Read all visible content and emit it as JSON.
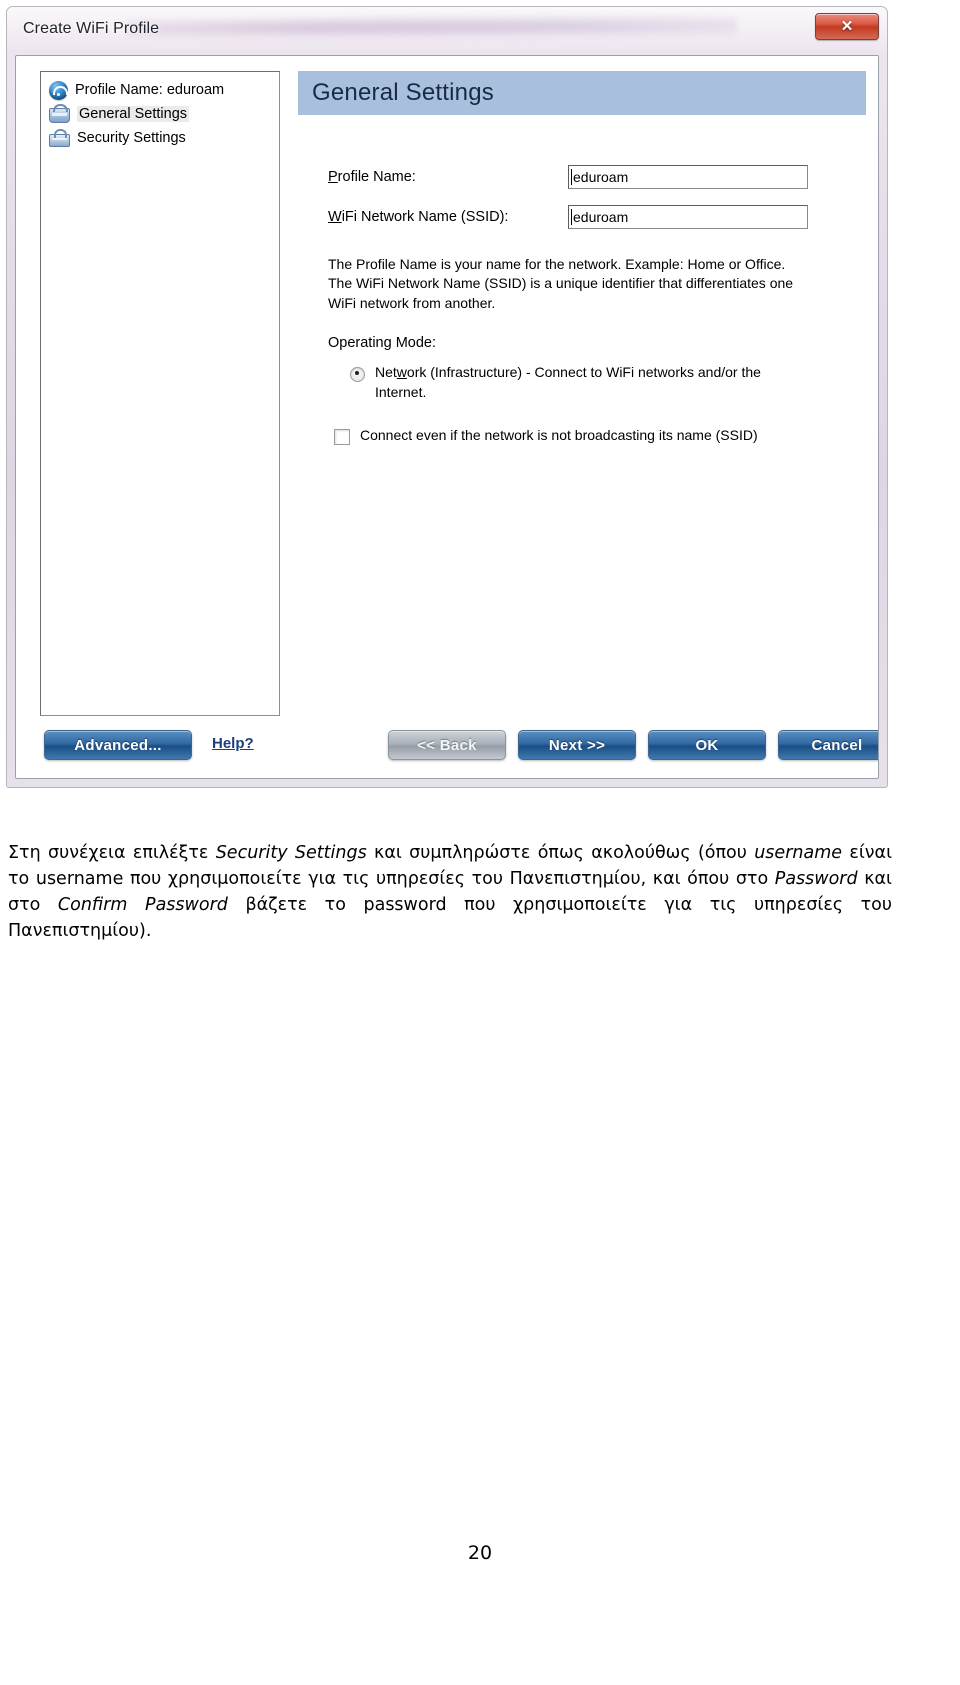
{
  "dialog": {
    "title": "Create WiFi Profile",
    "close_glyph": "✕",
    "close_name": "Close",
    "tree": {
      "items": [
        {
          "label": "Profile Name: eduroam",
          "icon": "wifi-icon",
          "selected": false
        },
        {
          "label": "General Settings",
          "icon": "general-settings-icon",
          "selected": true
        },
        {
          "label": "Security Settings",
          "icon": "security-settings-icon",
          "selected": false
        }
      ]
    },
    "section": {
      "header": "General Settings",
      "fields": [
        {
          "label_prefix": "P",
          "label_rest": "rofile Name:",
          "value": "eduroam"
        },
        {
          "label_prefix": "W",
          "label_rest": "iFi Network Name (SSID):",
          "value": "eduroam"
        }
      ],
      "help_paragraph": "The Profile Name is your name for the network. Example: Home or Office. The WiFi Network Name (SSID) is a unique identifier that differentiates one WiFi network from another.",
      "operating_mode_label": "Operating Mode:",
      "operating_mode_option": {
        "text_before": "Net",
        "accel": "w",
        "text_after": "ork (Infrastructure) - Connect to WiFi networks and/or the Internet.",
        "checked": true
      },
      "broadcast_option": {
        "text": "Connect even if the network is not broadcasting its name (SSID)",
        "checked": false
      }
    },
    "buttons": {
      "advanced": "Advanced...",
      "help": "Help?",
      "back": "<< Back",
      "next": "Next >>",
      "ok": "OK",
      "cancel": "Cancel",
      "back_disabled": true
    },
    "colors": {
      "header_band": "#a8c0dd",
      "primary_button": "#2f68a3",
      "disabled_button": "#aab1ba",
      "close_button": "#c23a22",
      "link": "#1b3f80"
    }
  },
  "document": {
    "line1_a": "Στη συνέχεια επιλέξτε ",
    "line1_em": "Security Settings",
    "line1_b": " και συμπληρώστε όπως ακολούθως (όπου ",
    "line2_em1": "username",
    "line2_a": " είναι το username που χρησιμοποιείτε για τις υπηρεσίες του Πανεπιστημίου, και όπου στο ",
    "line3_em1": "Password",
    "line3_a": " και στο ",
    "line3_em2": "Confirm Password",
    "line3_b": " βάζετε το password που χρησιμοποιείτε για τις υπηρεσίες του Πανεπιστημίου).",
    "page_number": "20"
  }
}
